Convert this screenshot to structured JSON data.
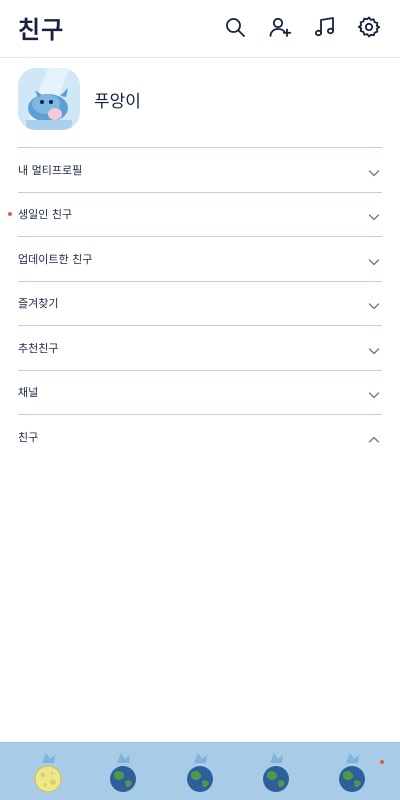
{
  "header": {
    "title": "친구",
    "icons": [
      "search-icon",
      "add-friend-icon",
      "music-icon",
      "settings-icon"
    ]
  },
  "profile": {
    "name": "푸앙이"
  },
  "sections": [
    {
      "label": "내 멀티프로필",
      "expanded": false
    },
    {
      "label": "생일인 친구",
      "expanded": false,
      "notification_dot": true
    },
    {
      "label": "업데이트한 친구",
      "expanded": false
    },
    {
      "label": "즐겨찾기",
      "expanded": false
    },
    {
      "label": "추천친구",
      "expanded": false
    },
    {
      "label": "채널",
      "expanded": false
    },
    {
      "label": "친구",
      "expanded": true
    }
  ],
  "tabbar": {
    "tabs": [
      "friends-tab-moon-icon",
      "chats-tab-earth-icon",
      "openchat-tab-earth-icon",
      "shopping-tab-earth-icon",
      "more-tab-earth-icon"
    ],
    "active_index": 0,
    "notification_on_last": true
  },
  "colors": {
    "accent": "#15233f",
    "divider": "#b9d2dc",
    "tabbar_bg": "#a8cbe7",
    "notification_dot": "#d9643a"
  }
}
